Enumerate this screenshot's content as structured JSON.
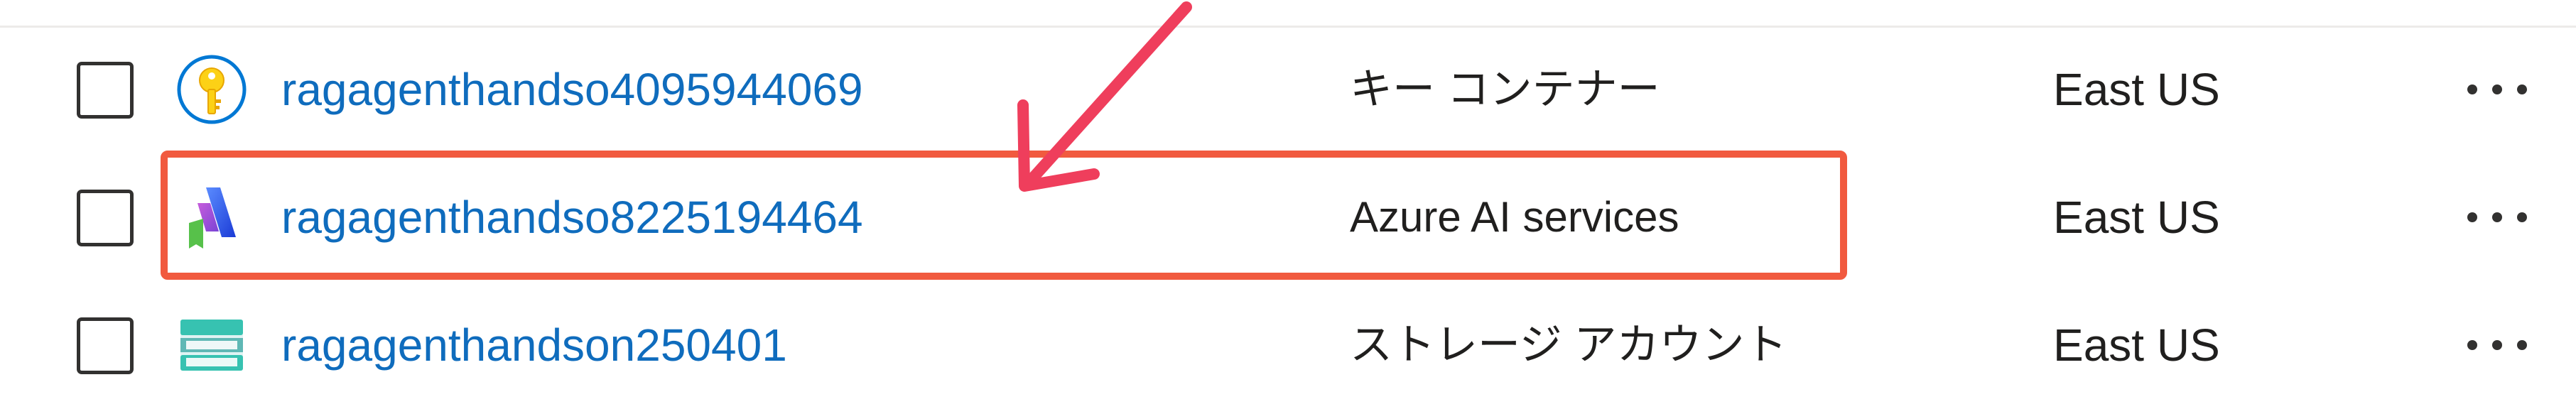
{
  "resources": [
    {
      "name": "ragagenthandso4095944069",
      "type": "キー コンテナー",
      "location": "East US",
      "icon": "key-vault-icon"
    },
    {
      "name": "ragagenthandso8225194464",
      "type": "Azure AI services",
      "location": "East US",
      "icon": "azure-ai-services-icon"
    },
    {
      "name": "ragagenthandson250401",
      "type": "ストレージ アカウント",
      "location": "East US",
      "icon": "storage-account-icon"
    }
  ],
  "annotation": {
    "highlight_color": "#f15a3f",
    "arrow_color": "#ef3e5c"
  },
  "colors": {
    "link": "#0f6cbd",
    "text": "#201f1e"
  }
}
